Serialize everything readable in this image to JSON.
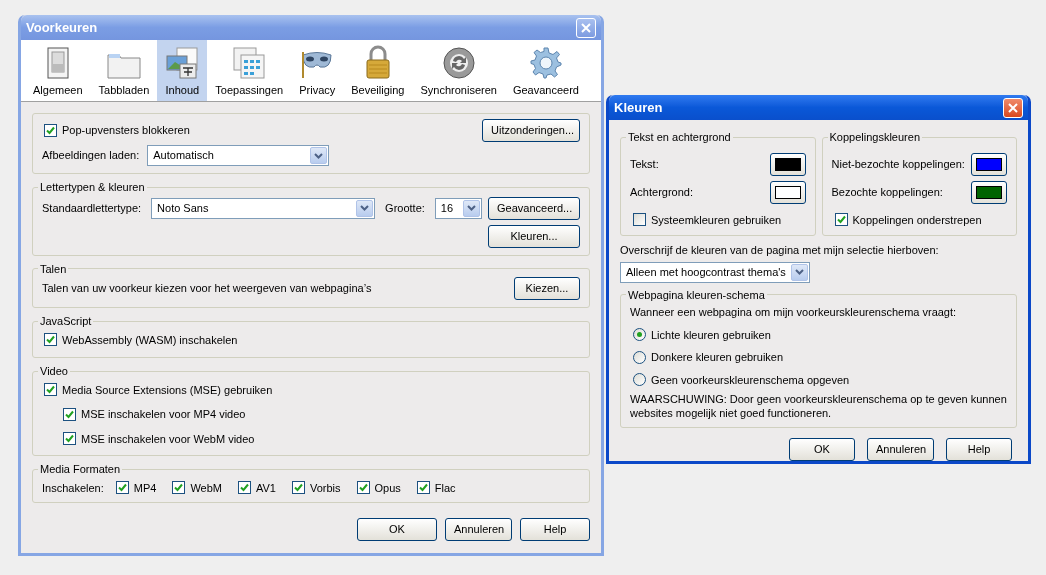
{
  "preferences": {
    "title": "Voorkeuren",
    "tabs": [
      {
        "label": "Algemeen",
        "selected": false
      },
      {
        "label": "Tabbladen",
        "selected": false
      },
      {
        "label": "Inhoud",
        "selected": true
      },
      {
        "label": "Toepassingen",
        "selected": false
      },
      {
        "label": "Privacy",
        "selected": false
      },
      {
        "label": "Beveiliging",
        "selected": false
      },
      {
        "label": "Synchroniseren",
        "selected": false
      },
      {
        "label": "Geavanceerd",
        "selected": false
      }
    ],
    "popups": {
      "checkbox": {
        "label": "Pop-upvensters blokkeren",
        "checked": true
      },
      "exceptions_button": "Uitzonderingen...",
      "images": {
        "label": "Afbeeldingen laden:",
        "value": "Automatisch"
      }
    },
    "fonts": {
      "title": "Lettertypen & kleuren",
      "default_font": {
        "label": "Standaardlettertype:",
        "value": "Noto Sans"
      },
      "size": {
        "label": "Grootte:",
        "value": "16"
      },
      "buttons": [
        "Geavanceerd...",
        "Kleuren..."
      ]
    },
    "languages": {
      "title": "Talen",
      "text": "Talen van uw voorkeur kiezen voor het weergeven van webpagina’s",
      "button": "Kiezen..."
    },
    "javascript": {
      "title": "JavaScript",
      "checkbox": {
        "label": "WebAssembly (WASM) inschakelen",
        "checked": true
      }
    },
    "video": {
      "title": "Video",
      "checkbox": {
        "label": "Media Source Extensions (MSE) gebruiken",
        "checked": true,
        "children": [
          {
            "label": "MSE inschakelen voor MP4 video",
            "checked": true
          },
          {
            "label": "MSE inschakelen voor WebM video",
            "checked": true
          }
        ]
      }
    },
    "media": {
      "title": "Media Formaten",
      "label": "Inschakelen:",
      "formats": [
        {
          "label": "MP4",
          "checked": true
        },
        {
          "label": "WebM",
          "checked": true
        },
        {
          "label": "AV1",
          "checked": true
        },
        {
          "label": "Vorbis",
          "checked": true
        },
        {
          "label": "Opus",
          "checked": true
        },
        {
          "label": "Flac",
          "checked": true
        }
      ]
    },
    "buttons": [
      "OK",
      "Annuleren",
      "Help"
    ]
  },
  "colors_dialog": {
    "title": "Kleuren",
    "text_background": {
      "title": "Tekst en achtergrond",
      "colors": [
        {
          "label": "Tekst:",
          "color": "#000000"
        },
        {
          "label": "Achtergrond:",
          "color": "#ffffff"
        }
      ],
      "checkbox": {
        "label": "Systeemkleuren gebruiken",
        "checked": false
      }
    },
    "link_colors": {
      "title": "Koppelingskleuren",
      "colors": [
        {
          "label": "Niet-bezochte koppelingen:",
          "color": "#0000ff"
        },
        {
          "label": "Bezochte koppelingen:",
          "color": "#006400"
        }
      ],
      "checkbox": {
        "label": "Koppelingen onderstrepen",
        "checked": true
      }
    },
    "override": {
      "label": "Overschrijf de kleuren van de pagina met mijn selectie hierboven:",
      "value": "Alleen met hoogcontrast thema's"
    },
    "scheme": {
      "title": "Webpagina kleuren-schema",
      "prompt": "Wanneer een webpagina om mijn voorkeurskleurenschema vraagt:",
      "options": [
        {
          "label": "Lichte kleuren gebruiken",
          "selected": true
        },
        {
          "label": "Donkere kleuren gebruiken",
          "selected": false
        },
        {
          "label": "Geen voorkeurskleurenschema opgeven",
          "selected": false
        }
      ],
      "warning": "WAARSCHUWING: Door geen voorkeurskleurenschema op te geven kunnen websites mogelijk niet goed functioneren."
    },
    "buttons": [
      "OK",
      "Annuleren",
      "Help"
    ]
  }
}
